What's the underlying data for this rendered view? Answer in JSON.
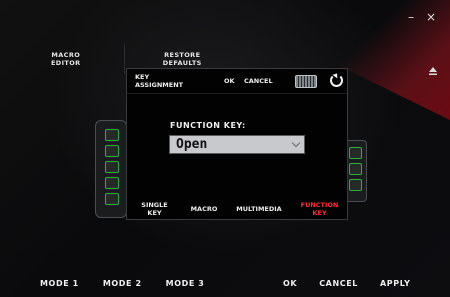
{
  "window": {
    "minimize": "–",
    "close": "×"
  },
  "top_tabs": [
    {
      "label": "MACRO\nEDITOR"
    },
    {
      "label": "RESTORE\nDEFAULTS"
    }
  ],
  "dialog": {
    "title": "KEY\nASSIGNMENT",
    "ok": "OK",
    "cancel": "CANCEL",
    "function_key_label": "FUNCTION KEY:",
    "function_key_value": "Open",
    "tabs": [
      {
        "label": "SINGLE\nKEY"
      },
      {
        "label": "MACRO"
      },
      {
        "label": "MULTIMEDIA"
      },
      {
        "label": "FUNCTION\nKEY",
        "active": true
      }
    ]
  },
  "bottom": {
    "modes": [
      "MODE 1",
      "MODE 2",
      "MODE 3"
    ],
    "ok": "OK",
    "cancel": "CANCEL",
    "apply": "APPLY"
  },
  "colors": {
    "accent_red": "#ff2a33",
    "green": "#2fae46",
    "background": "#0b0b0d"
  },
  "icons": {
    "eject": "eject-icon",
    "keyboard": "keyboard-icon",
    "refresh": "refresh-icon",
    "dropdown": "chevron-down-icon"
  }
}
